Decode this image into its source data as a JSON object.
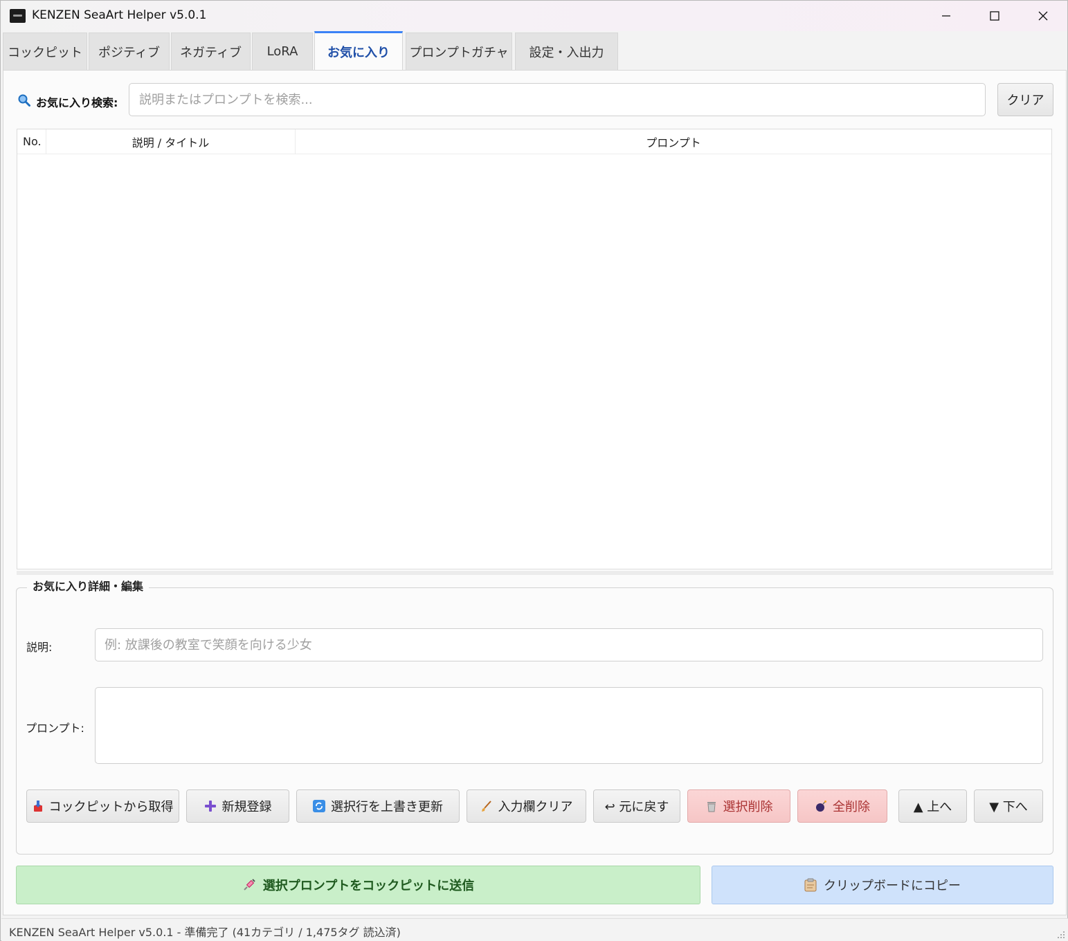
{
  "window": {
    "title": "KENZEN SeaArt Helper v5.0.1"
  },
  "tabs": [
    "コックピット",
    "ポジティブ",
    "ネガティブ",
    "LoRA",
    "お気に入り",
    "プロンプトガチャ",
    "設定・入出力"
  ],
  "active_tab": "お気に入り",
  "search": {
    "label": "お気に入り検索:",
    "placeholder": "説明またはプロンプトを検索...",
    "clear_label": "クリア"
  },
  "table": {
    "columns": [
      "No.",
      "説明 / タイトル",
      "プロンプト"
    ],
    "rows": []
  },
  "editor": {
    "group_title": "お気に入り詳細・編集",
    "desc_label": "説明:",
    "desc_placeholder": "例: 放課後の教室で笑顔を向ける少女",
    "prompt_label": "プロンプト:",
    "prompt_value": ""
  },
  "actions": {
    "fetch": "コックピットから取得",
    "new": "新規登録",
    "overwrite": "選択行を上書き更新",
    "clear_input": "入力欄クリア",
    "undo": "↩ 元に戻す",
    "delete_selected": "選択削除",
    "delete_all": "全削除",
    "up": "▲ 上へ",
    "down": "▼ 下へ"
  },
  "bottom": {
    "send": "選択プロンプトをコックピットに送信",
    "copy": "クリップボードにコピー"
  },
  "status": "KENZEN SeaArt Helper v5.0.1 - 準備完了 (41カテゴリ / 1,475タグ 読込済)",
  "colors": {
    "accent": "#3b82f6",
    "active_tab_text": "#1f4fa8",
    "danger_bg": "#f6c6c6",
    "send_bg": "#c9efc9",
    "copy_bg": "#cfe2fb"
  }
}
